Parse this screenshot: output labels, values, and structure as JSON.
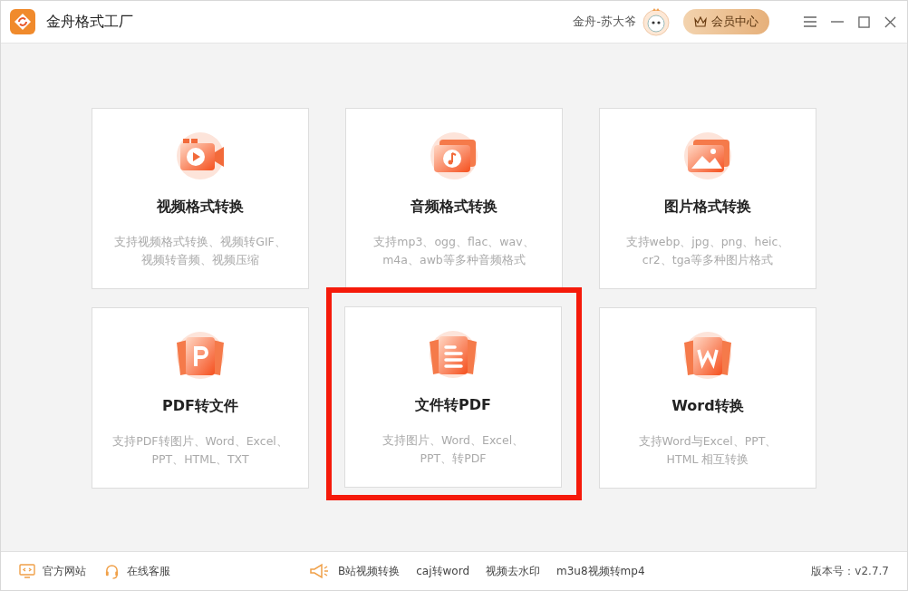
{
  "window": {
    "title": "金舟格式工厂",
    "user_name": "金舟-苏大爷",
    "vip_button": "会员中心"
  },
  "cards": [
    {
      "kind": "video",
      "title": "视频格式转换",
      "desc": [
        "支持视频格式转换、视频转GIF、",
        "视频转音频、视频压缩"
      ],
      "highlighted": false
    },
    {
      "kind": "audio",
      "title": "音频格式转换",
      "desc": [
        "支持mp3、ogg、flac、wav、",
        "m4a、awb等多种音频格式"
      ],
      "highlighted": false
    },
    {
      "kind": "image",
      "title": "图片格式转换",
      "desc": [
        "支持webp、jpg、png、heic、",
        "cr2、tga等多种图片格式"
      ],
      "highlighted": false
    },
    {
      "kind": "pdf",
      "title": "PDF转文件",
      "desc": [
        "支持PDF转图片、Word、Excel、",
        "PPT、HTML、TXT"
      ],
      "highlighted": false
    },
    {
      "kind": "doc",
      "title": "文件转PDF",
      "desc": [
        "支持图片、Word、Excel、",
        "PPT、转PDF"
      ],
      "highlighted": true
    },
    {
      "kind": "word",
      "title": "Word转换",
      "desc": [
        "支持Word与Excel、PPT、",
        "HTML 相互转换"
      ],
      "highlighted": false
    }
  ],
  "footer": {
    "left_links": [
      {
        "kind": "website",
        "label": "官方网站"
      },
      {
        "kind": "service",
        "label": "在线客服"
      }
    ],
    "center_links": [
      "B站视频转换",
      "caj转word",
      "视频去水印",
      "m3u8视频转mp4"
    ],
    "version": "版本号：v2.7.7"
  }
}
